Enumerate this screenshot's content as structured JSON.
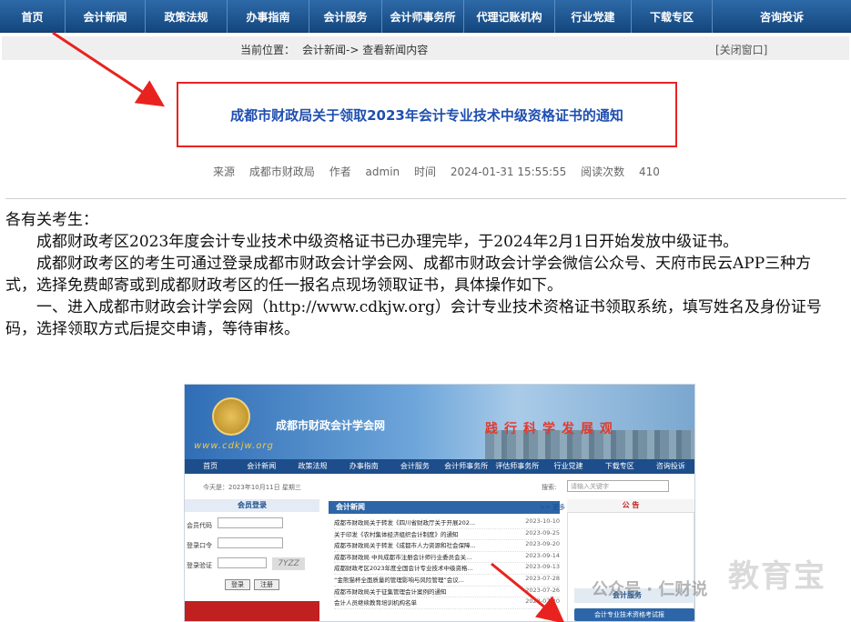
{
  "nav": {
    "items": [
      "首页",
      "会计新闻",
      "政策法规",
      "办事指南",
      "会计服务",
      "会计师事务所",
      "代理记账机构",
      "行业党建",
      "下载专区",
      "咨询投诉"
    ]
  },
  "breadcrumb": {
    "label": "当前位置：",
    "path": "会计新闻-> 查看新闻内容",
    "close": "[关闭窗口]"
  },
  "article": {
    "title": "成都市财政局关于领取2023年会计专业技术中级资格证书的通知",
    "meta": {
      "source_label": "来源",
      "source": "成都市财政局",
      "author_label": "作者",
      "author": "admin",
      "time_label": "时间",
      "time": "2024-01-31 15:55:55",
      "views_label": "阅读次数",
      "views": "410"
    },
    "paragraphs": [
      "各有关考生：",
      "成都财政考区2023年度会计专业技术中级资格证书已办理完毕，于2024年2月1日开始发放中级证书。",
      "成都财政考区的考生可通过登录成都市财政会计学会网、成都市财政会计学会微信公众号、天府市民云APP三种方式，选择免费邮寄或到成都财政考区的任一报名点现场领取证书，具体操作如下。",
      "一、进入成都市财政会计学会网（http://www.cdkjw.org）会计专业技术资格证书领取系统，填写姓名及身份证号码，选择领取方式后提交申请，等待审核。"
    ]
  },
  "embedded_site": {
    "url": "www.cdkjw.org",
    "name": "成都市财政会计学会网",
    "slogan": "践行科学发展观",
    "nav": [
      "首页",
      "会计新闻",
      "政策法规",
      "办事指南",
      "会计服务",
      "会计师事务所",
      "评估师事务所",
      "行业党建",
      "下载专区",
      "咨询投诉"
    ],
    "today": "今天是：2023年10月11日 星期三",
    "search_label": "搜索:",
    "search_placeholder": "请输入关键字",
    "member_login": "会员登录",
    "fields": [
      "会员代码",
      "登录口令",
      "登录验证"
    ],
    "captcha": "7YZZ",
    "login_btn": "登录",
    "register_btn": "注册",
    "news_head": "会计新闻",
    "more": ">> 更多",
    "notice_head": "公 告",
    "service_head": "会计服务",
    "exam_link": "会计专业技术资格考试报",
    "news": [
      {
        "title": "成都市财政局关于转发《四川省财政厅关于开展202...",
        "date": "2023-10-10"
      },
      {
        "title": "关于印发《农村集体经济组织会计制度》的通知",
        "date": "2023-09-25"
      },
      {
        "title": "成都市财政局关于转发《成都市人力资源和社会保障...",
        "date": "2023-09-20"
      },
      {
        "title": "成都市财政局 中共成都市注册会计师行业委员会关...",
        "date": "2023-09-14"
      },
      {
        "title": "成都财政考区2023年度全国会计专业技术中级资格...",
        "date": "2023-09-13"
      },
      {
        "title": "“金熊猫杯全面质量的管理影响与风险管理”会议...",
        "date": "2023-07-28"
      },
      {
        "title": "成都市财政局关于征集管理会计案例的通知",
        "date": "2023-07-26"
      },
      {
        "title": "会计人员继续教育培训机构名单",
        "date": "2023-07-20"
      }
    ]
  },
  "watermark": {
    "text": "公众号 · 仁财说",
    "brand": "教育宝"
  }
}
